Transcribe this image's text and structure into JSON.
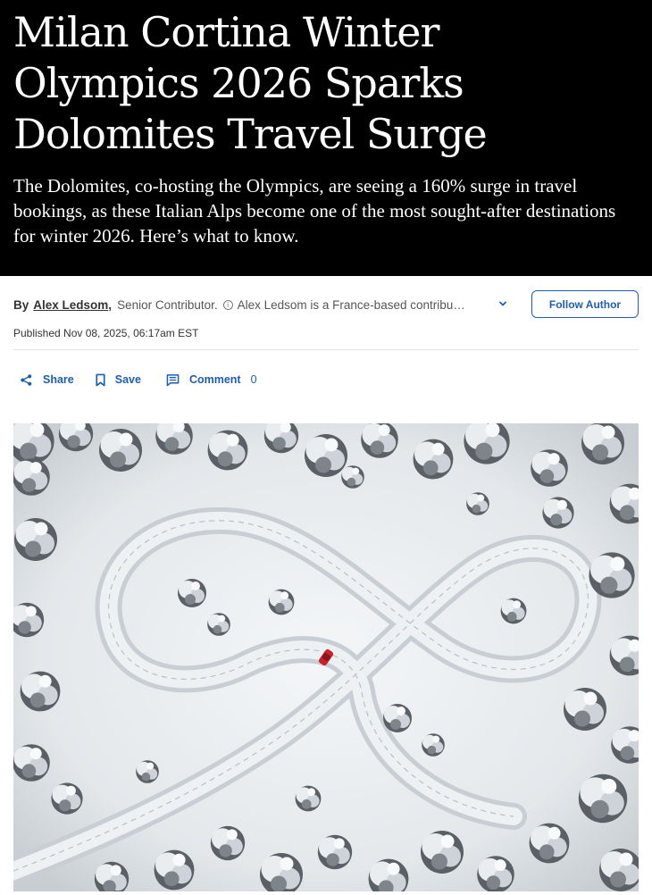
{
  "article": {
    "headline": "Milan Cortina Winter Olympics 2026 Sparks Dolomites Travel Surge",
    "dek": "The Dolomites, co-hosting the Olympics, are seeing a 160% surge in travel bookings, as these Italian Alps become one of the most sought-after destinations for winter 2026. Here’s what to know."
  },
  "byline": {
    "prefix": "By",
    "author": "Alex Ledsom",
    "comma": ",",
    "title": "Senior Contributor.",
    "info_icon": "info-icon",
    "bio": "Alex Ledsom is a France-based contributor",
    "expand_icon": "chevron-down-icon",
    "follow_label": "Follow Author"
  },
  "published": "Published Nov 08, 2025, 06:17am EST",
  "actions": {
    "share_label": "Share",
    "share_icon": "share-icon",
    "save_label": "Save",
    "save_icon": "bookmark-icon",
    "comment_label": "Comment",
    "comment_icon": "comment-icon",
    "comment_count": "0"
  },
  "colors": {
    "hero_background": "#000000",
    "link_blue": "#1f5dac",
    "car_red": "#c8232c"
  }
}
